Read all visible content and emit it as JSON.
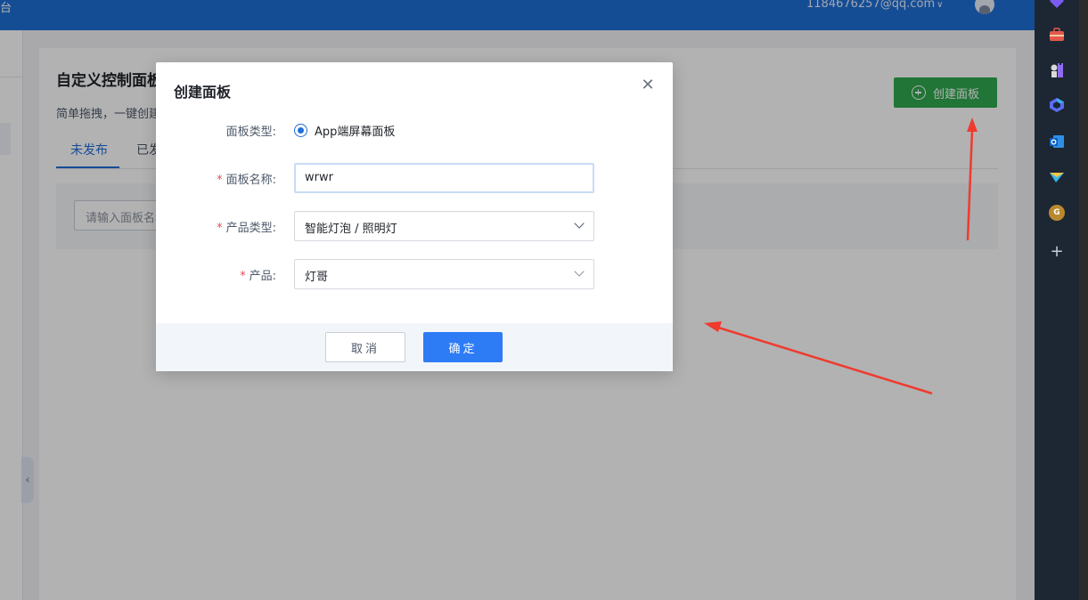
{
  "header": {
    "corner_text": "台",
    "user_email": "1184676257@qq.com",
    "email_chevron": "∨"
  },
  "page": {
    "title": "自定义控制面板",
    "subtitle": "简单拖拽，一键创建",
    "tabs": [
      {
        "label": "未发布",
        "active": true
      },
      {
        "label": "已发布",
        "active": false
      }
    ],
    "search_placeholder": "请输入面板名称",
    "create_button": "创建面板"
  },
  "modal": {
    "title": "创建面板",
    "close_glyph": "✕",
    "fields": {
      "panel_type": {
        "label": "面板类型:",
        "required": false,
        "option": "App端屏幕面板",
        "selected": true
      },
      "panel_name": {
        "label": "面板名称:",
        "required": true,
        "value": "wrwr"
      },
      "product_type": {
        "label": "产品类型:",
        "required": true,
        "value": "智能灯泡 / 照明灯"
      },
      "product": {
        "label": "产品:",
        "required": true,
        "value": "灯哥"
      }
    },
    "required_mark": "*",
    "cancel_label": "取消",
    "confirm_label": "确定"
  },
  "sidebar_collapse_glyph": "‹",
  "appbar": {
    "icons": [
      "diamond-icon",
      "toolbox-icon",
      "chess-icon",
      "copilot-icon",
      "outlook-icon",
      "send-icon",
      "g-avatar-icon",
      "add-icon"
    ],
    "g_letter": "G",
    "add_glyph": "+"
  },
  "colors": {
    "header_blue": "#1f6fd6",
    "create_green": "#2fa84f",
    "primary_button": "#2d7cf6",
    "required_red": "#e34d59",
    "annotation_arrow": "#f03a2e"
  }
}
